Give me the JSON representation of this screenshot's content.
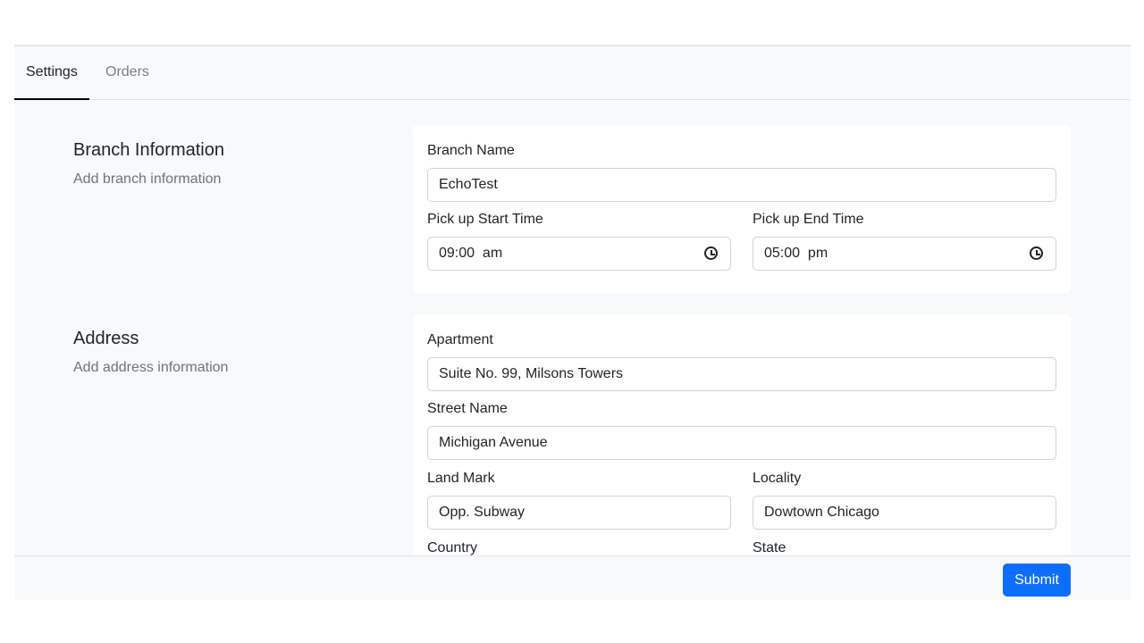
{
  "tabs": [
    {
      "label": "Settings",
      "active": true
    },
    {
      "label": "Orders",
      "active": false
    }
  ],
  "branch": {
    "title": "Branch Information",
    "subtitle": "Add branch information",
    "name_label": "Branch Name",
    "name_value": "EchoTest",
    "start_label": "Pick up Start Time",
    "start_value": "09:00  am",
    "end_label": "Pick up End Time",
    "end_value": "05:00  pm",
    "clock_icon": "clock-icon"
  },
  "address": {
    "title": "Address",
    "subtitle": "Add address information",
    "apartment_label": "Apartment",
    "apartment_value": "Suite No. 99, Milsons Towers",
    "street_label": "Street Name",
    "street_value": "Michigan Avenue",
    "landmark_label": "Land Mark",
    "landmark_value": "Opp. Subway",
    "locality_label": "Locality",
    "locality_value": "Dowtown Chicago",
    "country_label": "Country",
    "state_label": "State"
  },
  "footer": {
    "submit_label": "Submit"
  },
  "colors": {
    "primary": "#0d6efd",
    "background": "#f8f9fa"
  }
}
